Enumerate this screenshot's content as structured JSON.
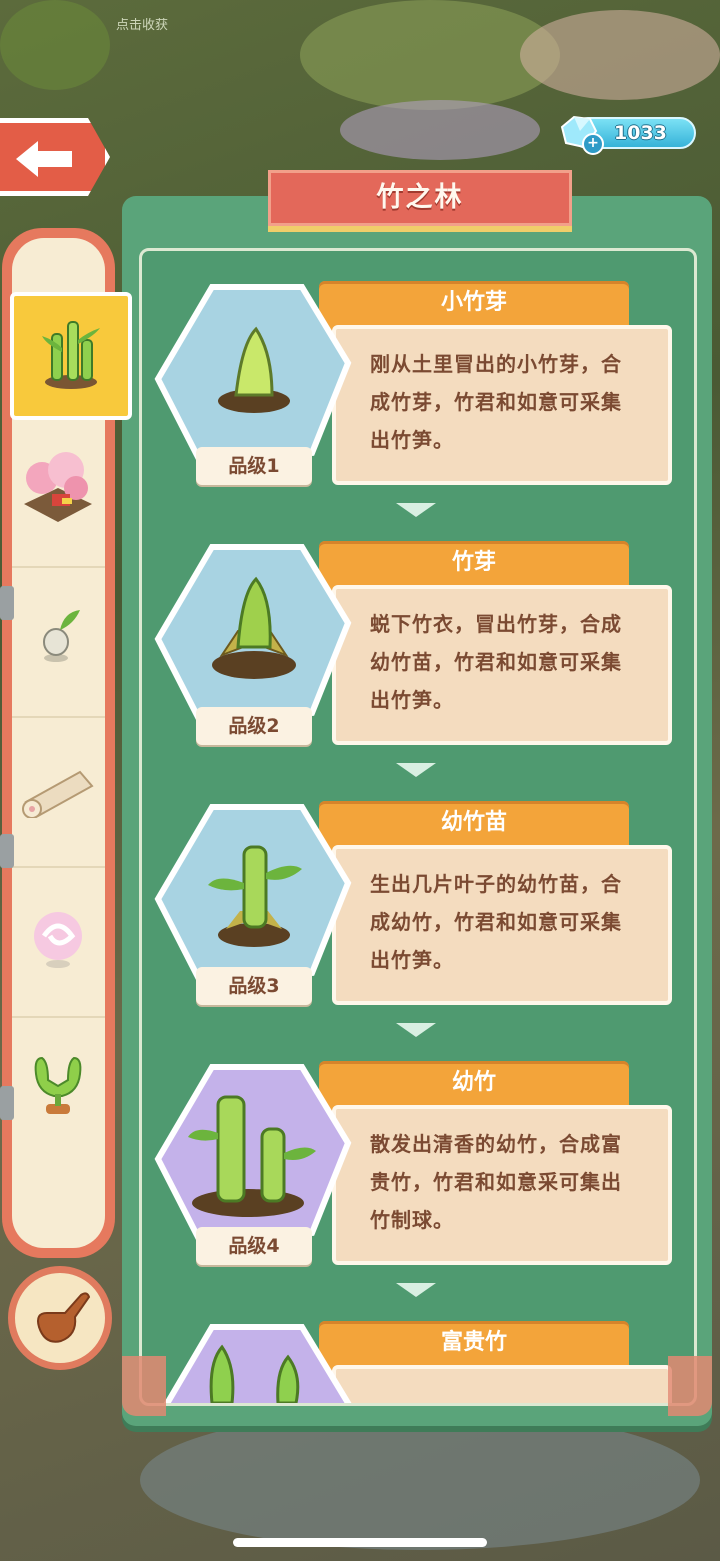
{
  "background": {
    "top_text": "点击收获"
  },
  "currency": {
    "amount": "1033",
    "plus_label": "+"
  },
  "panel": {
    "title": "竹之林"
  },
  "items": [
    {
      "name": "小竹芽",
      "description": "刚从土里冒出的小竹芽，合成竹芽，竹君和如意可采集出竹笋。",
      "grade": "品级1",
      "icon": "bamboo-sprout-icon",
      "hex_color": "#a8d3e2"
    },
    {
      "name": "竹芽",
      "description": "蜕下竹衣，冒出竹芽，合成幼竹苗，竹君和如意可采集出竹笋。",
      "grade": "品级2",
      "icon": "bamboo-shoot-icon",
      "hex_color": "#a8d3e2"
    },
    {
      "name": "幼竹苗",
      "description": "生出几片叶子的幼竹苗，合成幼竹，竹君和如意可采集出竹笋。",
      "grade": "品级3",
      "icon": "bamboo-seedling-icon",
      "hex_color": "#a8d3e2"
    },
    {
      "name": "幼竹",
      "description": "散发出清香的幼竹，合成富贵竹，竹君和如意采可集出竹制球。",
      "grade": "品级4",
      "icon": "young-bamboo-icon",
      "hex_color": "#c4b2ea"
    },
    {
      "name": "富贵竹",
      "description": "",
      "grade": "",
      "icon": "lucky-bamboo-icon",
      "hex_color": "#c4b2ea"
    }
  ],
  "sidebar": {
    "tabs": [
      {
        "icon": "bamboo-category-icon",
        "active": true
      },
      {
        "icon": "blossom-garden-icon",
        "active": false
      },
      {
        "icon": "seed-bulb-icon",
        "active": false
      },
      {
        "icon": "wood-log-icon",
        "active": false
      },
      {
        "icon": "pink-swirl-orb-icon",
        "active": false
      },
      {
        "icon": "cactus-sprout-icon",
        "active": false
      }
    ]
  }
}
